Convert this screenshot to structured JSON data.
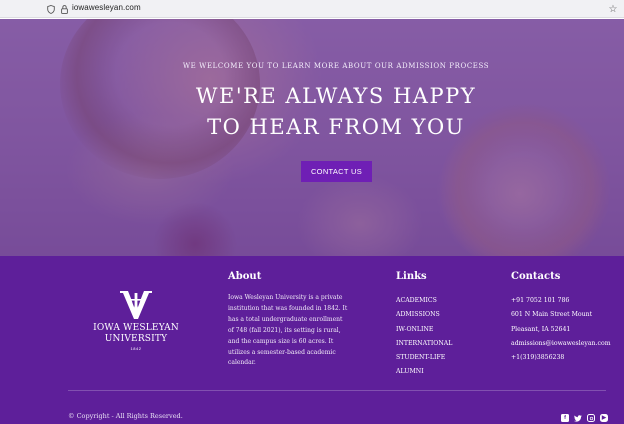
{
  "browser": {
    "url": "iowawesleyan.com",
    "icons": [
      "shield-icon",
      "lock-icon",
      "bookmark-star-icon"
    ]
  },
  "hero": {
    "eyebrow": "WE WELCOME YOU TO LEARN MORE ABOUT OUR ADMISSION PROCESS",
    "headline": "WE'RE ALWAYS HAPPY TO HEAR FROM YOU",
    "cta_label": "CONTACT US",
    "overlay_color": "#581c87"
  },
  "footer": {
    "background_color": "#5e1f9a",
    "logo": {
      "name": "IOWA WESLEYAN UNIVERSITY",
      "year": "1842"
    },
    "about": {
      "title": "About",
      "text": "Iowa Wesleyan University is a private institution that was founded in 1842. It has a total undergraduate enrollment of 748 (fall 2021), its setting is rural, and the campus size is 60 acres. It utilizes a semester-based academic calendar."
    },
    "links": {
      "title": "Links",
      "items": [
        "ACADEMICS",
        "ADMISSIONS",
        "IW-ONLINE",
        "INTERNATIONAL",
        "STUDENT-LIFE",
        "ALUMNI"
      ]
    },
    "contacts": {
      "title": "Contacts",
      "items": [
        "+91 7052 101 786",
        "601 N Main Street Mount",
        "Pleasant, IA 52641",
        "admissions@iowawesleyan.com",
        "+1(319)3856238"
      ]
    },
    "copyright": "© Copyright - All Rights Reserved.",
    "social": [
      "facebook-icon",
      "twitter-icon",
      "instagram-icon",
      "youtube-icon"
    ]
  }
}
